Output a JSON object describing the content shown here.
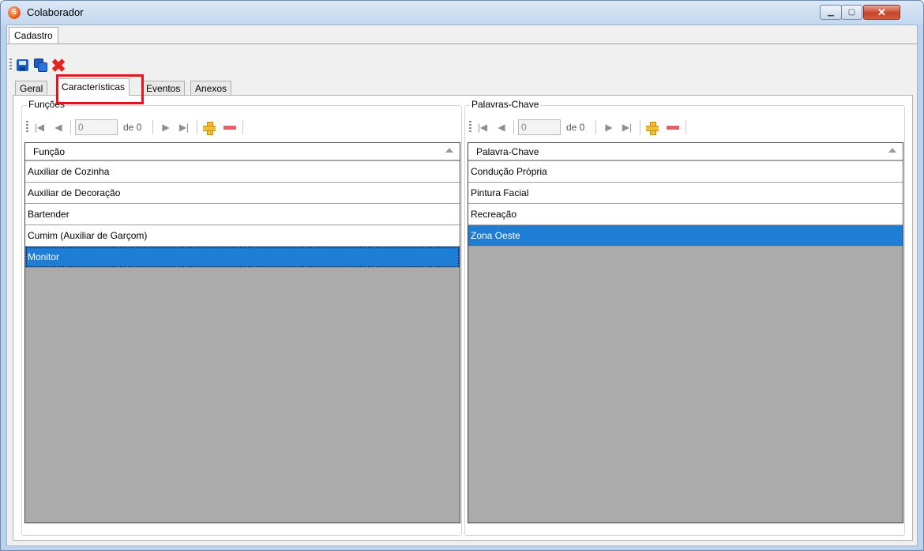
{
  "window": {
    "title": "Colaborador",
    "app_icon_glyph": "5",
    "controls": {
      "minimize": "▁",
      "maximize": "▢",
      "close": "✕"
    }
  },
  "menu": {
    "items": [
      "Cadastro"
    ]
  },
  "toolbar": {
    "buttons": [
      {
        "icon": "save-icon"
      },
      {
        "icon": "save-all-icon"
      },
      {
        "icon": "cancel-icon",
        "glyph": "✖",
        "color": "#e2241b"
      }
    ]
  },
  "tabs": {
    "items": [
      "Geral",
      "Características",
      "Eventos",
      "Anexos"
    ],
    "active": "Características",
    "highlight_color": "#e5141c"
  },
  "panels": [
    {
      "title": "Funções",
      "navigator": {
        "position": "0",
        "count": "de 0",
        "first": "|◀",
        "prev": "◀",
        "next": "▶",
        "last": "▶|"
      },
      "column": "Função",
      "rows": [
        "Auxiliar de Cozinha",
        "Auxiliar de Decoração",
        "Bartender",
        "Cumim (Auxiliar de Garçom)",
        "Monitor"
      ],
      "selected": "Monitor"
    },
    {
      "title": "Palavras-Chave",
      "navigator": {
        "position": "0",
        "count": "de 0",
        "first": "|◀",
        "prev": "◀",
        "next": "▶",
        "last": "▶|"
      },
      "column": "Palavra-Chave",
      "rows": [
        "Condução Própria",
        "Pintura Facial",
        "Recreação",
        "Zona Oeste"
      ],
      "selected": "Zona Oeste"
    }
  ],
  "colors": {
    "selection": "#1e7ed6",
    "grid_background": "#ababab",
    "title_bar": "#c3d7ee"
  }
}
